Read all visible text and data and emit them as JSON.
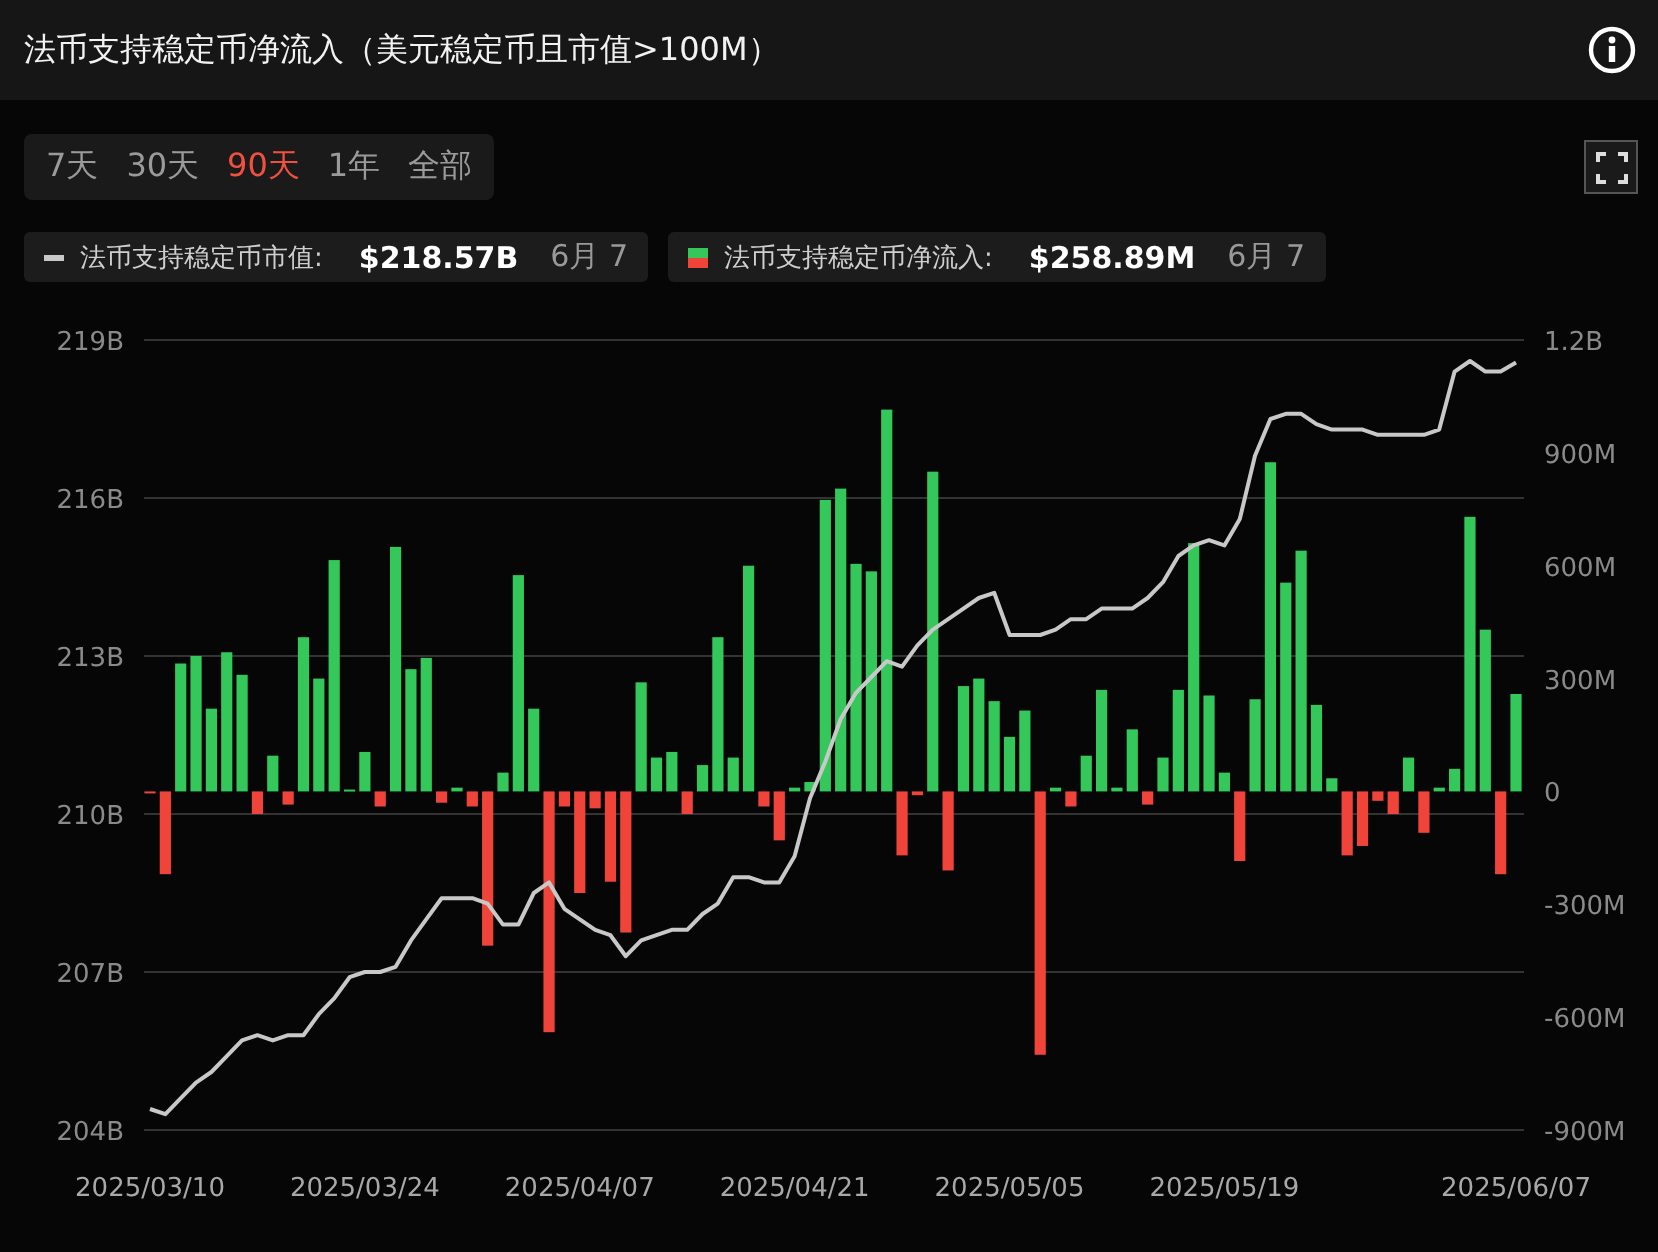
{
  "header": {
    "title": "法币支持稳定币净流入（美元稳定币且市值>100M）"
  },
  "range_tabs": [
    {
      "label": "7天",
      "selected": false
    },
    {
      "label": "30天",
      "selected": false
    },
    {
      "label": "90天",
      "selected": true
    },
    {
      "label": "1年",
      "selected": false
    },
    {
      "label": "全部",
      "selected": false
    }
  ],
  "legend": [
    {
      "kind": "line",
      "value": "$218.57B",
      "date": "6月 7"
    },
    {
      "kind": "bar",
      "value": "$258.89M",
      "date": "6月 7"
    }
  ],
  "chart": {
    "chart_data": {
      "type": "bar",
      "grid": true,
      "categories": [
        "2025/03/10",
        null,
        null,
        null,
        null,
        null,
        null,
        null,
        null,
        null,
        null,
        null,
        null,
        null,
        "2025/03/24",
        null,
        null,
        null,
        null,
        null,
        null,
        null,
        null,
        null,
        null,
        null,
        null,
        null,
        "2025/04/07",
        null,
        null,
        null,
        null,
        null,
        null,
        null,
        null,
        null,
        null,
        null,
        null,
        null,
        "2025/04/21",
        null,
        null,
        null,
        null,
        null,
        null,
        null,
        null,
        null,
        null,
        null,
        null,
        null,
        "2025/05/05",
        null,
        null,
        null,
        null,
        null,
        null,
        null,
        null,
        null,
        null,
        null,
        null,
        null,
        "2025/05/19",
        null,
        null,
        null,
        null,
        null,
        null,
        null,
        null,
        null,
        null,
        null,
        null,
        null,
        null,
        null,
        null,
        null,
        null,
        "2025/06/07"
      ],
      "ylim": [
        -900000000,
        1200000000
      ],
      "yticks": [
        {
          "value": 1200000000,
          "label": "1.2B"
        },
        {
          "value": 900000000,
          "label": "900M"
        },
        {
          "value": 600000000,
          "label": "600M"
        },
        {
          "value": 300000000,
          "label": "300M"
        },
        {
          "value": 0,
          "label": "0"
        },
        {
          "value": -300000000,
          "label": "-300M"
        },
        {
          "value": -600000000,
          "label": "-600M"
        },
        {
          "value": -900000000,
          "label": "-900M"
        }
      ],
      "y2lim": [
        204000000000,
        219000000000
      ],
      "y2ticks": [
        {
          "value": 219000000000,
          "label": "219B"
        },
        {
          "value": 216000000000,
          "label": "216B"
        },
        {
          "value": 213000000000,
          "label": "213B"
        },
        {
          "value": 210000000000,
          "label": "210B"
        },
        {
          "value": 207000000000,
          "label": "207B"
        },
        {
          "value": 204000000000,
          "label": "204B"
        }
      ],
      "series": [
        {
          "name": "法币支持稳定币净流入:",
          "type": "bar",
          "colors": [
            "#f0443a",
            "#f0443a",
            "#34c759",
            "#34c759",
            "#34c759",
            "#34c759",
            "#34c759",
            "#f0443a",
            "#34c759",
            "#f0443a",
            "#34c759",
            "#34c759",
            "#34c759",
            "#34c759",
            "#34c759",
            "#f0443a",
            "#34c759",
            "#34c759",
            "#34c759",
            "#f0443a",
            "#34c759",
            "#f0443a",
            "#f0443a",
            "#34c759",
            "#34c759",
            "#34c759",
            "#f0443a",
            "#f0443a",
            "#f0443a",
            "#f0443a",
            "#f0443a",
            "#f0443a",
            "#34c759",
            "#34c759",
            "#34c759",
            "#f0443a",
            "#34c759",
            "#34c759",
            "#34c759",
            "#34c759",
            "#f0443a",
            "#f0443a",
            "#34c759",
            "#34c759",
            "#34c759",
            "#34c759",
            "#34c759",
            "#34c759",
            "#34c759",
            "#f0443a",
            "#f0443a",
            "#34c759",
            "#f0443a",
            "#34c759",
            "#34c759",
            "#34c759",
            "#34c759",
            "#34c759",
            "#f0443a",
            "#34c759",
            "#f0443a",
            "#34c759",
            "#34c759",
            "#34c759",
            "#34c759",
            "#f0443a",
            "#34c759",
            "#34c759",
            "#34c759",
            "#34c759",
            "#34c759",
            "#f0443a",
            "#34c759",
            "#34c759",
            "#34c759",
            "#34c759",
            "#34c759",
            "#34c759",
            "#f0443a",
            "#f0443a",
            "#f0443a",
            "#f0443a",
            "#34c759",
            "#f0443a",
            "#34c759",
            "#34c759",
            "#34c759",
            "#34c759",
            "#f0443a",
            "#34c759"
          ],
          "values": [
            -5000000,
            -220000000,
            340000000,
            360000000,
            220000000,
            370000000,
            310000000,
            -60000000,
            95000000,
            -35000000,
            410000000,
            300000000,
            615000000,
            5000000,
            105000000,
            -40000000,
            650000000,
            325000000,
            355000000,
            -30000000,
            10000000,
            -40000000,
            -410000000,
            50000000,
            575000000,
            220000000,
            -640000000,
            -40000000,
            -270000000,
            -45000000,
            -240000000,
            -375000000,
            290000000,
            90000000,
            105000000,
            -60000000,
            70000000,
            410000000,
            90000000,
            600000000,
            -40000000,
            -130000000,
            10000000,
            25000000,
            775000000,
            805000000,
            605000000,
            585000000,
            1015000000,
            -170000000,
            -10000000,
            850000000,
            -210000000,
            280000000,
            300000000,
            240000000,
            145000000,
            215000000,
            -700000000,
            10000000,
            -40000000,
            95000000,
            270000000,
            10000000,
            165000000,
            -35000000,
            90000000,
            270000000,
            660000000,
            255000000,
            50000000,
            -185000000,
            245000000,
            875000000,
            555000000,
            640000000,
            230000000,
            35000000,
            -170000000,
            -145000000,
            -25000000,
            -60000000,
            90000000,
            -110000000,
            10000000,
            60000000,
            730000000,
            430000000,
            -220000000,
            259000000
          ]
        },
        {
          "name": "法币支持稳定币市值:",
          "type": "line",
          "axis": "y2",
          "color": "#c8c8c8",
          "values": [
            204400000000,
            204300000000,
            204600000000,
            204900000000,
            205100000000,
            205400000000,
            205700000000,
            205800000000,
            205700000000,
            205800000000,
            205800000000,
            206200000000,
            206500000000,
            206900000000,
            207000000000,
            207000000000,
            207100000000,
            207600000000,
            208000000000,
            208400000000,
            208400000000,
            208400000000,
            208300000000,
            207900000000,
            207900000000,
            208500000000,
            208700000000,
            208200000000,
            208000000000,
            207800000000,
            207700000000,
            207300000000,
            207600000000,
            207700000000,
            207800000000,
            207800000000,
            208100000000,
            208300000000,
            208800000000,
            208800000000,
            208700000000,
            208700000000,
            209200000000,
            210300000000,
            211000000000,
            211800000000,
            212300000000,
            212600000000,
            212900000000,
            212800000000,
            213200000000,
            213500000000,
            213700000000,
            213900000000,
            214100000000,
            214200000000,
            213400000000,
            213400000000,
            213400000000,
            213500000000,
            213700000000,
            213700000000,
            213900000000,
            213900000000,
            213900000000,
            214100000000,
            214400000000,
            214900000000,
            215100000000,
            215200000000,
            215100000000,
            215600000000,
            216800000000,
            217500000000,
            217600000000,
            217600000000,
            217400000000,
            217300000000,
            217300000000,
            217300000000,
            217200000000,
            217200000000,
            217200000000,
            217200000000,
            217300000000,
            218400000000,
            218600000000,
            218400000000,
            218400000000,
            218570000000
          ]
        }
      ]
    }
  }
}
